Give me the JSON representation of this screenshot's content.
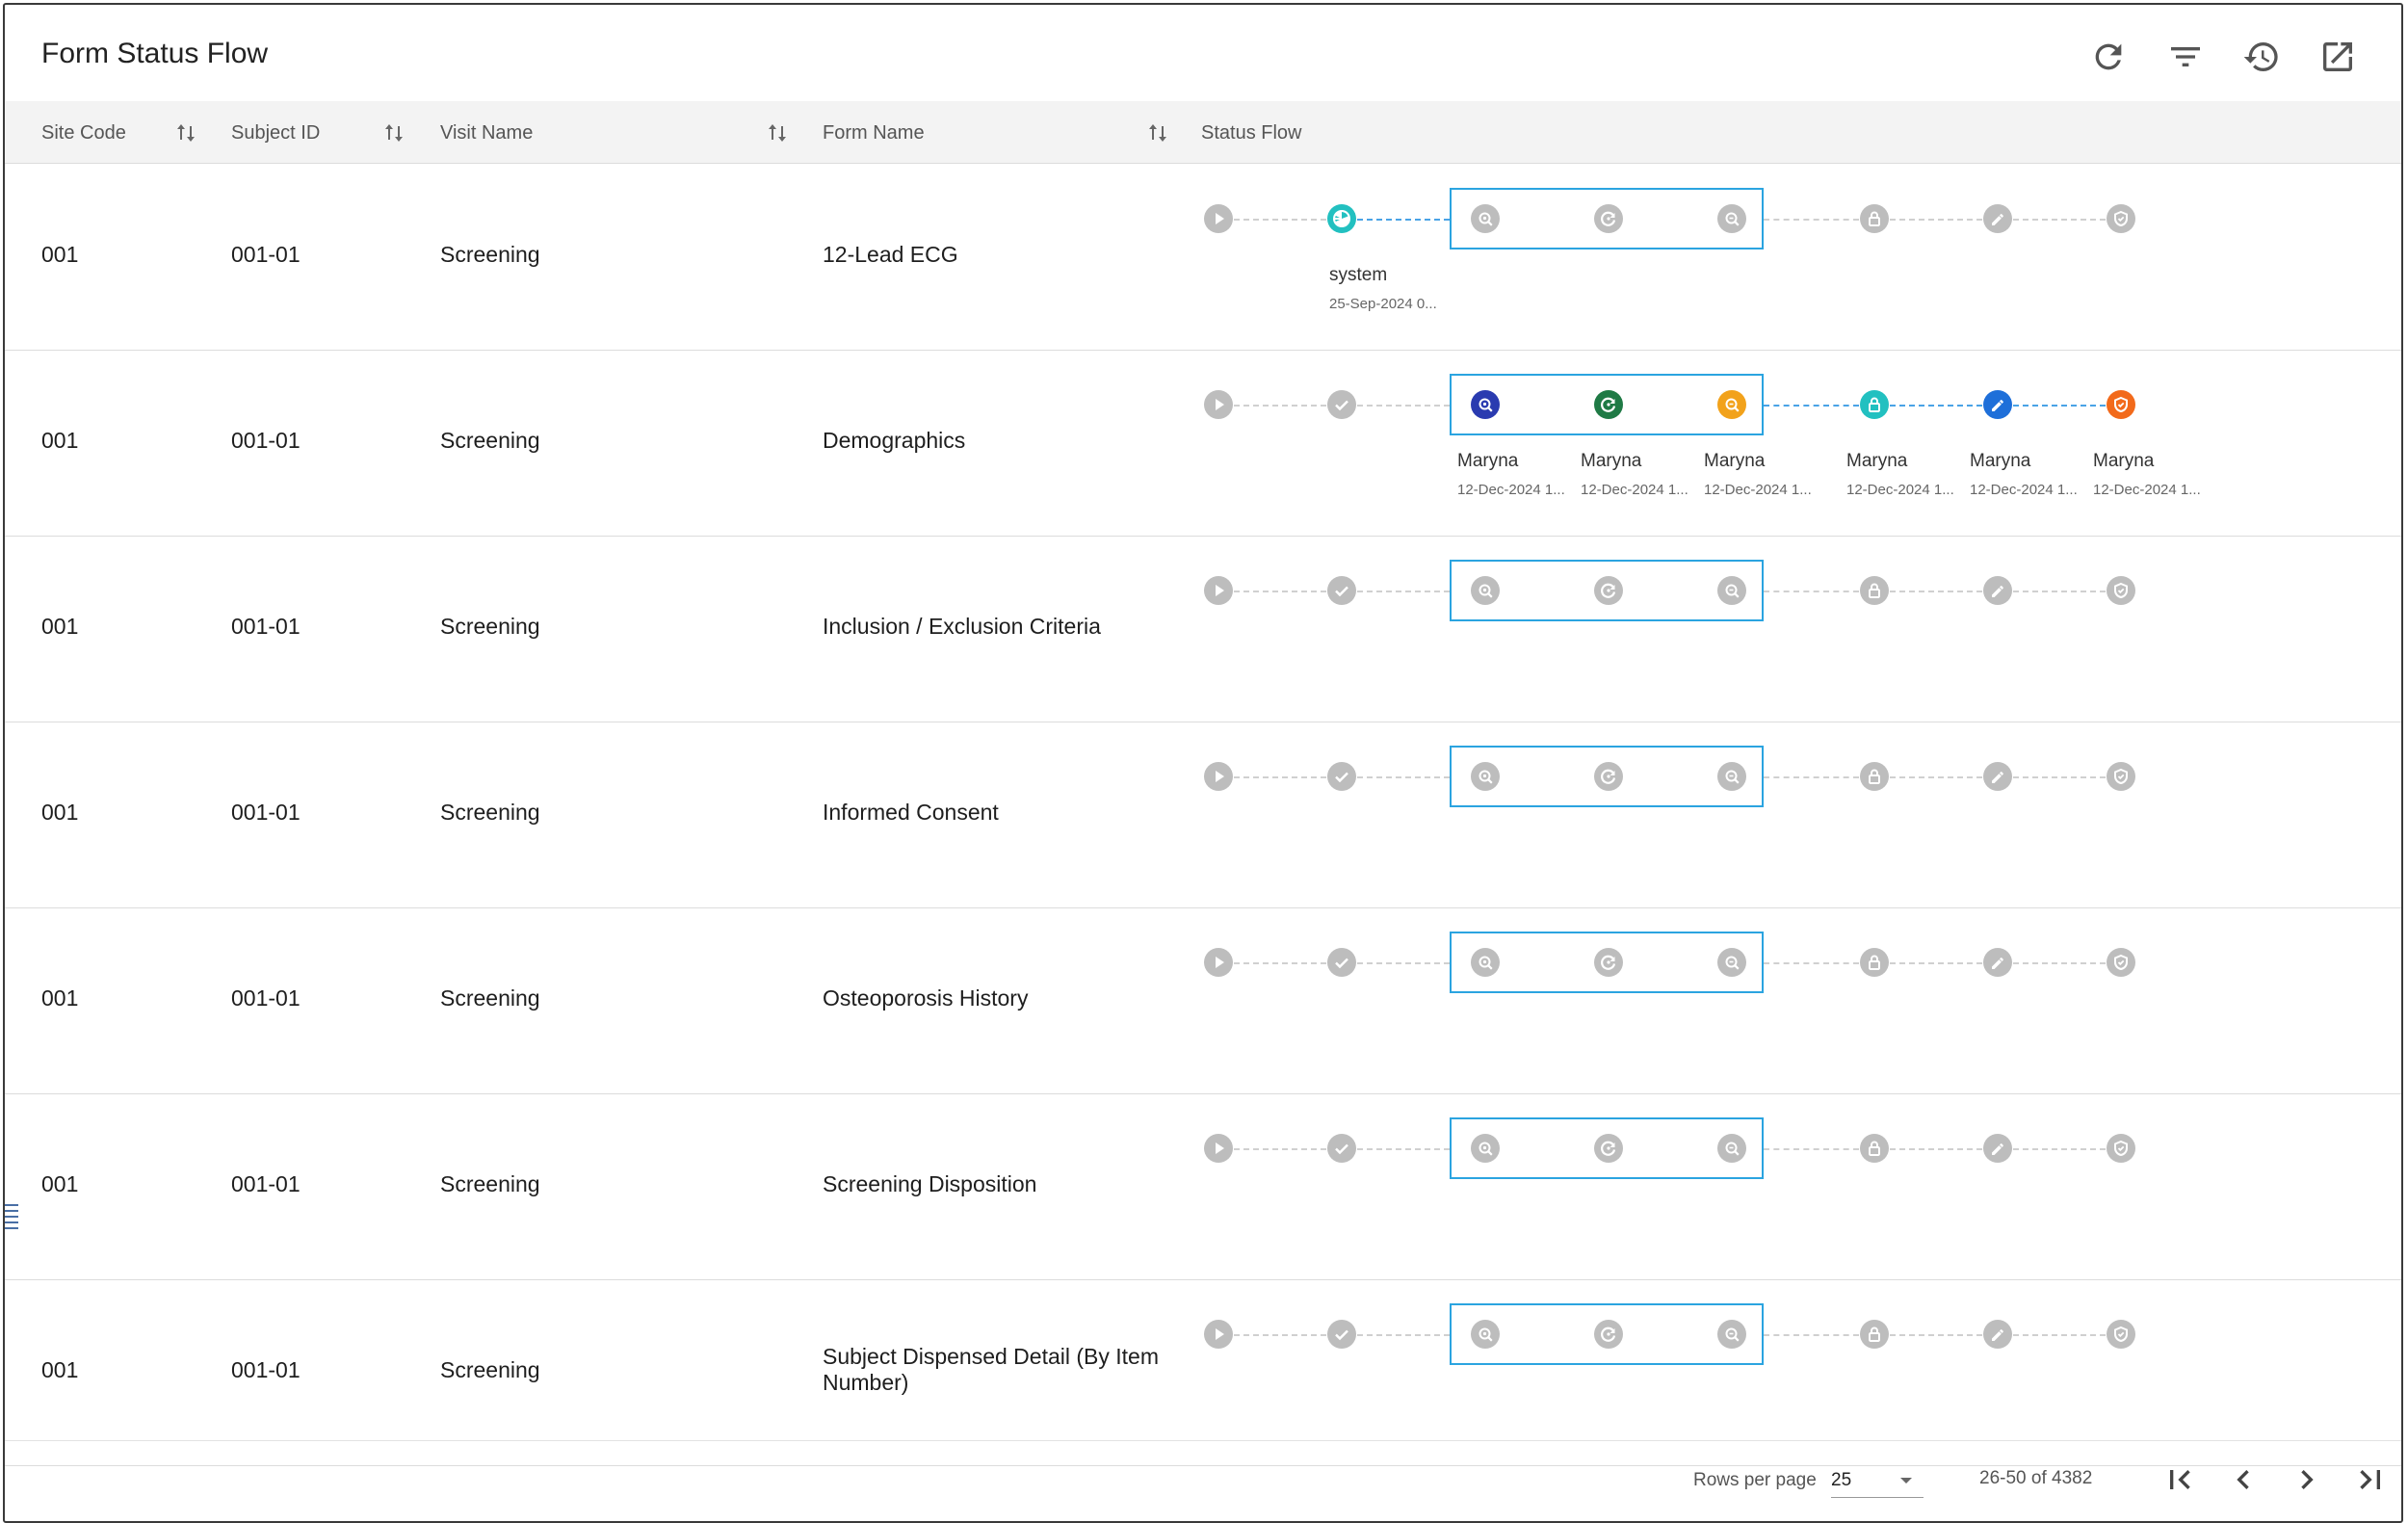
{
  "title": "Form Status Flow",
  "toolbar": {
    "refresh_icon": "refresh-icon",
    "filter_icon": "filter-icon",
    "history_icon": "history-icon",
    "open_external_icon": "open-external-icon"
  },
  "columns": {
    "site_code": "Site Code",
    "subject_id": "Subject ID",
    "visit_name": "Visit Name",
    "form_name": "Form Name",
    "status_flow": "Status Flow"
  },
  "status_steps": [
    "start",
    "completed",
    "query-open",
    "query-answered",
    "query-closed",
    "locked",
    "signed",
    "verified"
  ],
  "colors": {
    "inactive": "#bdbdbd",
    "completed_teal": "#22c0c0",
    "query_open_navy": "#2a3bb0",
    "query_answered_green": "#1f7a45",
    "query_closed_amber": "#f2a21b",
    "locked_teal": "#22c0c0",
    "signed_blue": "#1e6fd9",
    "verified_orange": "#f26a1b",
    "highlight_box": "#2ba4e0",
    "active_line": "#4aa3e6"
  },
  "rows": [
    {
      "site": "001",
      "subject": "001-01",
      "visit": "Screening",
      "form": "12-Lead ECG",
      "steps": [
        {
          "state": "inactive"
        },
        {
          "state": "partial",
          "user": "system",
          "date": "25-Sep-2024 0..."
        },
        {
          "state": "inactive"
        },
        {
          "state": "inactive"
        },
        {
          "state": "inactive"
        },
        {
          "state": "inactive"
        },
        {
          "state": "inactive"
        },
        {
          "state": "inactive"
        }
      ]
    },
    {
      "site": "001",
      "subject": "001-01",
      "visit": "Screening",
      "form": "Demographics",
      "steps": [
        {
          "state": "inactive"
        },
        {
          "state": "inactive"
        },
        {
          "state": "query-open",
          "user": "Maryna",
          "date": "12-Dec-2024 1..."
        },
        {
          "state": "query-answered",
          "user": "Maryna",
          "date": "12-Dec-2024 1..."
        },
        {
          "state": "query-closed",
          "user": "Maryna",
          "date": "12-Dec-2024 1..."
        },
        {
          "state": "locked",
          "user": "Maryna",
          "date": "12-Dec-2024 1..."
        },
        {
          "state": "signed",
          "user": "Maryna",
          "date": "12-Dec-2024 1..."
        },
        {
          "state": "verified",
          "user": "Maryna",
          "date": "12-Dec-2024 1..."
        }
      ]
    },
    {
      "site": "001",
      "subject": "001-01",
      "visit": "Screening",
      "form": "Inclusion / Exclusion Criteria",
      "steps": []
    },
    {
      "site": "001",
      "subject": "001-01",
      "visit": "Screening",
      "form": "Informed Consent",
      "steps": []
    },
    {
      "site": "001",
      "subject": "001-01",
      "visit": "Screening",
      "form": "Osteoporosis History",
      "steps": []
    },
    {
      "site": "001",
      "subject": "001-01",
      "visit": "Screening",
      "form": "Screening Disposition",
      "steps": []
    },
    {
      "site": "001",
      "subject": "001-01",
      "visit": "Screening",
      "form": "Subject Dispensed Detail (By Item Number)",
      "steps": []
    }
  ],
  "pagination": {
    "rows_per_page_label": "Rows per page",
    "rows_per_page_value": "25",
    "range_label": "26-50 of 4382"
  }
}
